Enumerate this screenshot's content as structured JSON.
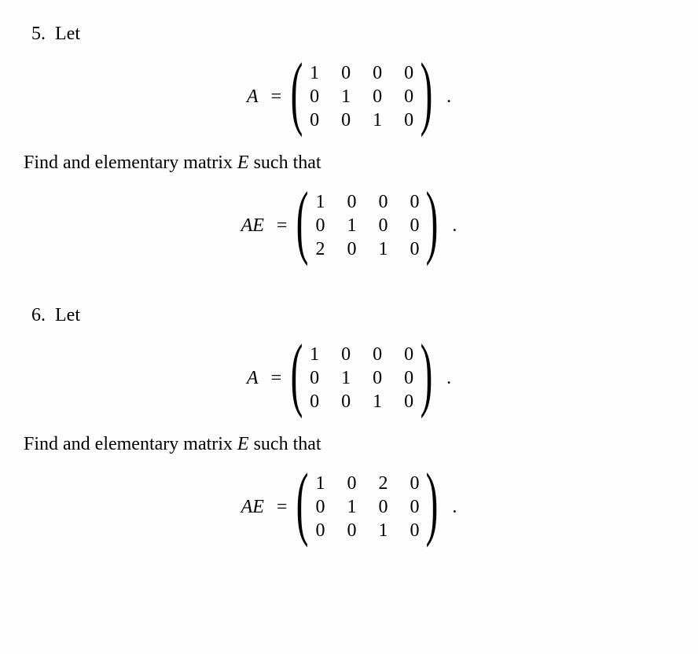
{
  "problems": [
    {
      "number": "5.",
      "intro": "Let",
      "A_label": "A",
      "equals": "=",
      "A_matrix": [
        [
          "1",
          "0",
          "0",
          "0"
        ],
        [
          "0",
          "1",
          "0",
          "0"
        ],
        [
          "0",
          "0",
          "1",
          "0"
        ]
      ],
      "find_text_prefix": "Find and elementary matrix ",
      "find_var": "E",
      "find_text_suffix": " such that",
      "AE_label_A": "A",
      "AE_label_E": "E",
      "AE_matrix": [
        [
          "1",
          "0",
          "0",
          "0"
        ],
        [
          "0",
          "1",
          "0",
          "0"
        ],
        [
          "2",
          "0",
          "1",
          "0"
        ]
      ],
      "period": "."
    },
    {
      "number": "6.",
      "intro": "Let",
      "A_label": "A",
      "equals": "=",
      "A_matrix": [
        [
          "1",
          "0",
          "0",
          "0"
        ],
        [
          "0",
          "1",
          "0",
          "0"
        ],
        [
          "0",
          "0",
          "1",
          "0"
        ]
      ],
      "find_text_prefix": "Find and elementary matrix ",
      "find_var": "E",
      "find_text_suffix": " such that",
      "AE_label_A": "A",
      "AE_label_E": "E",
      "AE_matrix": [
        [
          "1",
          "0",
          "2",
          "0"
        ],
        [
          "0",
          "1",
          "0",
          "0"
        ],
        [
          "0",
          "0",
          "1",
          "0"
        ]
      ],
      "period": "."
    }
  ],
  "chart_data": {
    "type": "table",
    "description": "Two linear algebra problems asking to find elementary matrix E from given A and AE.",
    "problems": [
      {
        "id": 5,
        "A": [
          [
            1,
            0,
            0,
            0
          ],
          [
            0,
            1,
            0,
            0
          ],
          [
            0,
            0,
            1,
            0
          ]
        ],
        "AE": [
          [
            1,
            0,
            0,
            0
          ],
          [
            0,
            1,
            0,
            0
          ],
          [
            2,
            0,
            1,
            0
          ]
        ]
      },
      {
        "id": 6,
        "A": [
          [
            1,
            0,
            0,
            0
          ],
          [
            0,
            1,
            0,
            0
          ],
          [
            0,
            0,
            1,
            0
          ]
        ],
        "AE": [
          [
            1,
            0,
            2,
            0
          ],
          [
            0,
            1,
            0,
            0
          ],
          [
            0,
            0,
            1,
            0
          ]
        ]
      }
    ]
  }
}
